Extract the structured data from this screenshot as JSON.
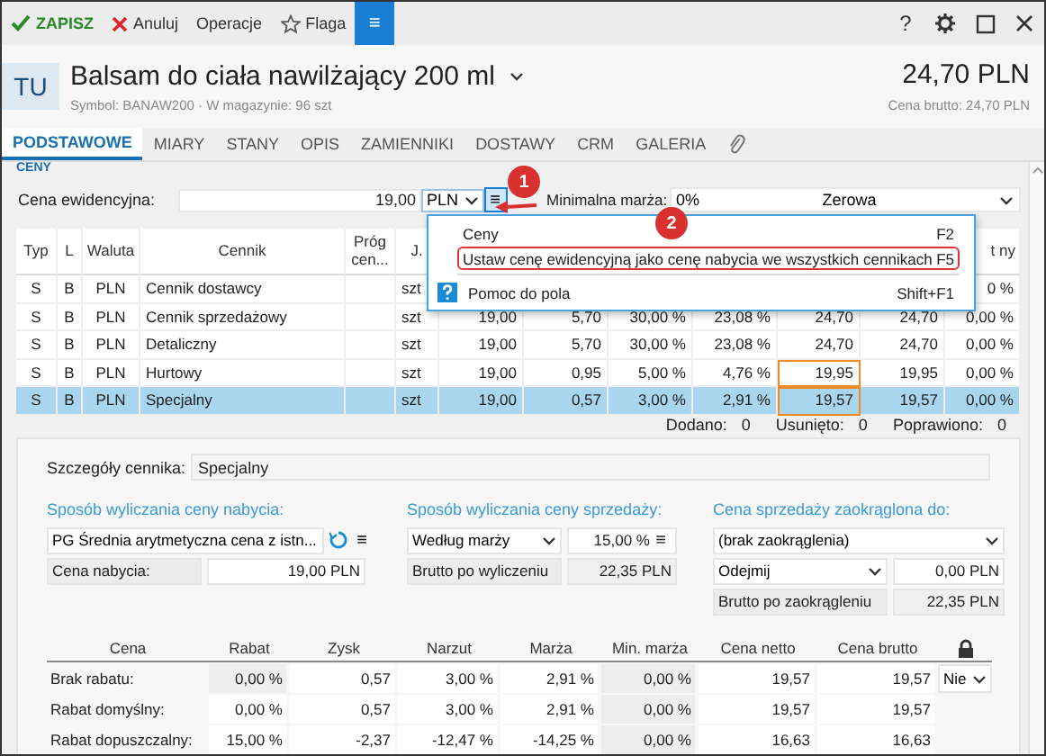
{
  "toolbar": {
    "buttons": [
      {
        "kind": "save",
        "label": "ZAPISZ"
      },
      {
        "kind": "cancel",
        "label": "Anuluj"
      },
      {
        "kind": "plain",
        "label": "Operacje"
      },
      {
        "kind": "flag",
        "label": "Flaga"
      },
      {
        "kind": "menu",
        "label": "≡"
      }
    ],
    "window_controls": [
      {
        "kind": "help",
        "label": "?"
      },
      {
        "kind": "settings"
      },
      {
        "kind": "maximize"
      },
      {
        "kind": "close"
      }
    ]
  },
  "header": {
    "avatar": "TU",
    "title": "Balsam do ciała nawilżający 200 ml",
    "subtitle": "Symbol: BANAW200 · W magazynie: 96 szt",
    "price": "24,70 PLN",
    "price_note": "Cena brutto: 24,70 PLN"
  },
  "tabs": [
    {
      "kind": "text",
      "label": "PODSTAWOWE",
      "selected": true
    },
    {
      "kind": "text",
      "label": "MIARY",
      "selected": false
    },
    {
      "kind": "text",
      "label": "STANY",
      "selected": false
    },
    {
      "kind": "text",
      "label": "OPIS",
      "selected": false
    },
    {
      "kind": "text",
      "label": "ZAMIENNIKI",
      "selected": false
    },
    {
      "kind": "text",
      "label": "DOSTAWY",
      "selected": false
    },
    {
      "kind": "text",
      "label": "CRM",
      "selected": false
    },
    {
      "kind": "text",
      "label": "GALERIA",
      "selected": false
    },
    {
      "kind": "attachment",
      "selected": false
    }
  ],
  "section_label": "CENY",
  "price_form": {
    "label": "Cena ewidencyjna:",
    "value": "19,00",
    "currency": "PLN",
    "menu_button": "≡",
    "min_margin_label": "Minimalna marża:",
    "min_margin_value": "0%",
    "min_margin_option": "Zerowa"
  },
  "price_table": {
    "columns": [
      "Typ",
      "L",
      "Waluta",
      "Cennik",
      "Próg cen...",
      "J.",
      null,
      null,
      null,
      null,
      null,
      null,
      "t ny"
    ],
    "rows": [
      {
        "cells": [
          "S",
          "B",
          "PLN",
          "Cennik dostawcy",
          null,
          "szt",
          null,
          null,
          null,
          null,
          null,
          null,
          "0 %"
        ],
        "selected": false,
        "modified": false
      },
      {
        "cells": [
          "S",
          "B",
          "PLN",
          "Cennik sprzedażowy",
          null,
          "szt",
          "19,00",
          "5,70",
          "30,00 %",
          "23,08 %",
          "24,70",
          "24,70",
          "0,00 %"
        ],
        "selected": false,
        "modified": false
      },
      {
        "cells": [
          "S",
          "B",
          "PLN",
          "Detaliczny",
          null,
          "szt",
          "19,00",
          "5,70",
          "30,00 %",
          "23,08 %",
          "24,70",
          "24,70",
          "0,00 %"
        ],
        "selected": false,
        "modified": false
      },
      {
        "cells": [
          "S",
          "B",
          "PLN",
          "Hurtowy",
          null,
          "szt",
          "19,00",
          "0,95",
          "5,00 %",
          "4,76 %",
          "19,95",
          "19,95",
          "0,00 %"
        ],
        "selected": false,
        "modified": true
      },
      {
        "cells": [
          "S",
          "B",
          "PLN",
          "Specjalny",
          null,
          "szt",
          "19,00",
          "0,57",
          "3,00 %",
          "2,91 %",
          "19,57",
          "19,57",
          "0,00 %"
        ],
        "selected": true,
        "modified": true
      }
    ],
    "counters": [
      {
        "label": "Dodano:",
        "value": "0"
      },
      {
        "label": "Usunięto:",
        "value": "0"
      },
      {
        "label": "Poprawiono:",
        "value": "0"
      }
    ]
  },
  "details": {
    "label": "Szczegóły cennika:",
    "value": "Specjalny",
    "purchase": {
      "title": "Sposób wyliczania ceny nabycia:",
      "method": "PG Średnia arytmetyczna cena z istn...",
      "menu_button": "≡",
      "label": "Cena nabycia:",
      "value": "19,00 PLN"
    },
    "sale": {
      "title": "Sposób wyliczania ceny sprzedaży:",
      "method": "Według marży",
      "percent": "15,00 %",
      "menu_button": "≡",
      "label": "Brutto po wyliczeniu",
      "value": "22,35 PLN"
    },
    "rounding": {
      "title": "Cena sprzedaży zaokrąglona do:",
      "option": "(brak zaokrąglenia)",
      "operation": "Odejmij",
      "operation_value": "0,00 PLN",
      "label": "Brutto po zaokrągleniu",
      "value": "22,35 PLN"
    },
    "discounts": {
      "columns": [
        "Cena",
        "Rabat",
        "Zysk",
        "Narzut",
        "Marża",
        "Min. marża",
        "Cena netto",
        "Cena brutto"
      ],
      "rows": [
        {
          "cells": [
            "Brak rabatu:",
            "0,00 %",
            "0,57",
            "3,00 %",
            "2,91 %",
            "0,00 %",
            "19,57",
            "19,57"
          ],
          "lock_option": "Nie"
        },
        {
          "cells": [
            "Rabat domyślny:",
            "0,00 %",
            "0,57",
            "3,00 %",
            "2,91 %",
            "0,00 %",
            "19,57",
            "19,57"
          ]
        },
        {
          "cells": [
            "Rabat dopuszczalny:",
            "15,00 %",
            "-2,37",
            "-12,47 %",
            "-14,25 %",
            "0,00 %",
            "16,63",
            "16,63"
          ]
        }
      ]
    }
  },
  "context_menu": {
    "items": [
      {
        "kind": "item",
        "label": "Ceny",
        "shortcut": "F2",
        "selected": false
      },
      {
        "kind": "item",
        "label": "Ustaw cenę ewidencyjną jako cenę nabycia we wszystkich cennikach",
        "shortcut": "F5",
        "selected": true
      },
      {
        "kind": "separator"
      },
      {
        "kind": "help",
        "label": "Pomoc do pola",
        "shortcut": "Shift+F1",
        "selected": false
      }
    ]
  },
  "callouts": [
    {
      "label": "1"
    },
    {
      "label": "2"
    }
  ]
}
